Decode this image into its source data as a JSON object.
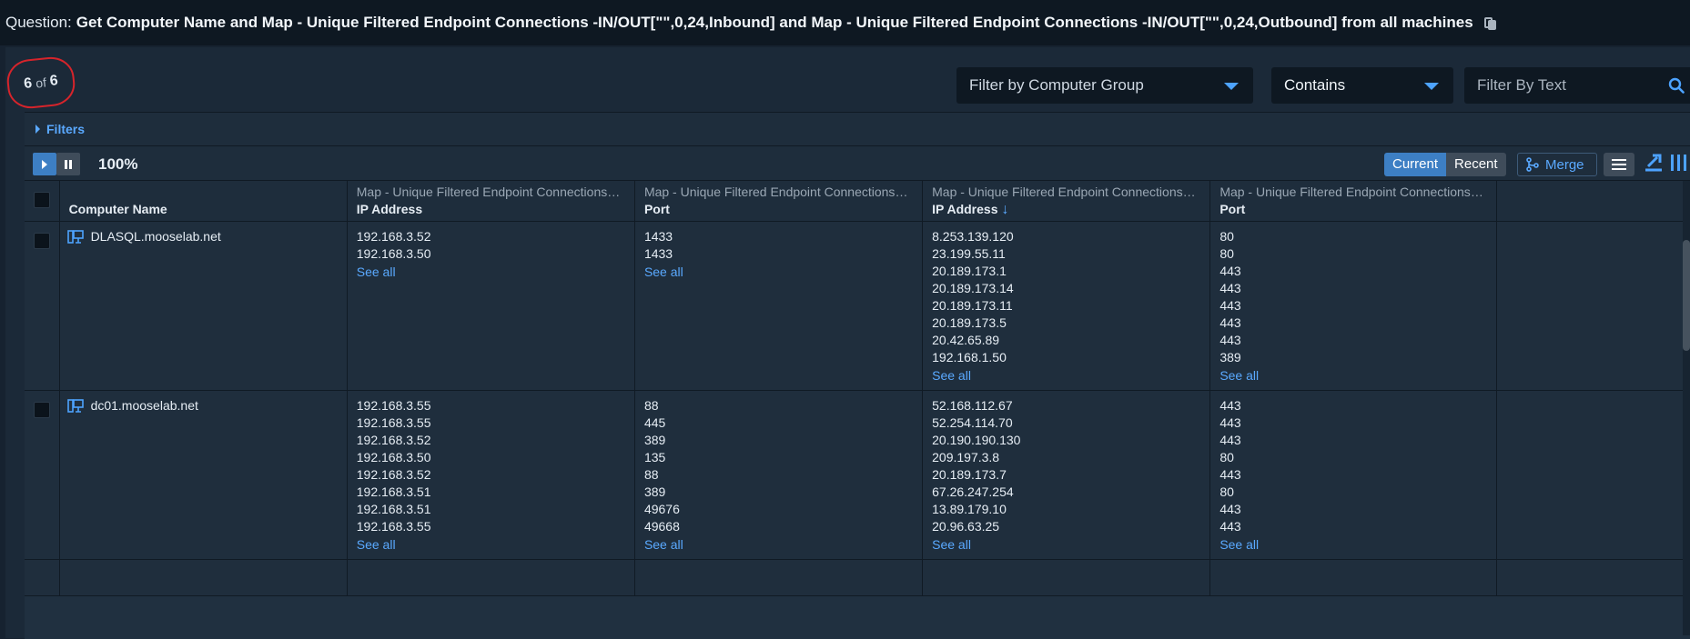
{
  "question": {
    "label": "Question:",
    "text": "Get Computer Name and Map - Unique Filtered Endpoint Connections -IN/OUT[\"\",0,24,Inbound] and Map - Unique Filtered Endpoint Connections -IN/OUT[\"\",0,24,Outbound] from all machines"
  },
  "count": {
    "shown": "6",
    "of": "of",
    "total": "6"
  },
  "filters": {
    "group_select": "Filter by Computer Group",
    "match_select": "Contains",
    "text_placeholder": "Filter By Text"
  },
  "filters_toggle": "Filters",
  "toolbar": {
    "progress": "100%",
    "current": "Current",
    "recent": "Recent",
    "merge": "Merge"
  },
  "columns": {
    "computer_name": "Computer Name",
    "c1_top": "Map - Unique Filtered Endpoint Connections -I...",
    "c1_main": "IP Address",
    "c2_top": "Map - Unique Filtered Endpoint Connections -I...",
    "c2_main": "Port",
    "c3_top": "Map - Unique Filtered Endpoint Connections -I...",
    "c3_main": "IP Address",
    "c4_top": "Map - Unique Filtered Endpoint Connections -I...",
    "c4_main": "Port"
  },
  "see_all": "See all",
  "rows": [
    {
      "name": "DLASQL.mooselab.net",
      "in_ip": [
        "192.168.3.52",
        "192.168.3.50"
      ],
      "in_port": [
        "1433",
        "1433"
      ],
      "out_ip": [
        "8.253.139.120",
        "23.199.55.11",
        "20.189.173.1",
        "20.189.173.14",
        "20.189.173.11",
        "20.189.173.5",
        "20.42.65.89",
        "192.168.1.50"
      ],
      "out_port": [
        "80",
        "80",
        "443",
        "443",
        "443",
        "443",
        "443",
        "389"
      ]
    },
    {
      "name": "dc01.mooselab.net",
      "in_ip": [
        "192.168.3.55",
        "192.168.3.55",
        "192.168.3.52",
        "192.168.3.50",
        "192.168.3.52",
        "192.168.3.51",
        "192.168.3.51",
        "192.168.3.55"
      ],
      "in_port": [
        "88",
        "445",
        "389",
        "135",
        "88",
        "389",
        "49676",
        "49668"
      ],
      "out_ip": [
        "52.168.112.67",
        "52.254.114.70",
        "20.190.190.130",
        "209.197.3.8",
        "20.189.173.7",
        "67.26.247.254",
        "13.89.179.10",
        "20.96.63.25"
      ],
      "out_port": [
        "443",
        "443",
        "443",
        "80",
        "443",
        "80",
        "443",
        "443"
      ]
    }
  ]
}
